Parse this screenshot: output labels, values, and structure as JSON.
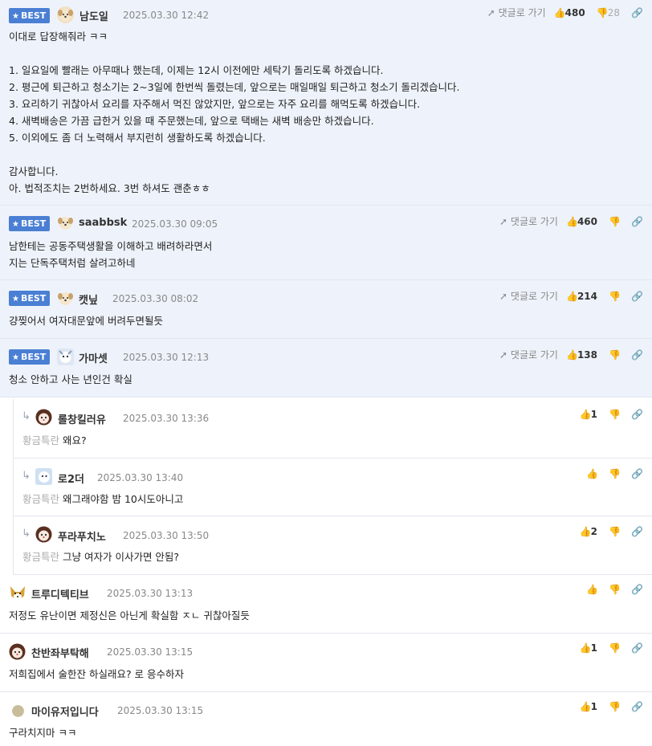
{
  "ui": {
    "goto_label": "댓글로 가기",
    "best_label": "BEST",
    "reply_tag": "황금특란"
  },
  "icons": {
    "thumb_up": "thumb-up-icon",
    "thumb_down": "thumb-down-icon",
    "link": "link-icon",
    "reply": "reply-arrow-icon",
    "arrow": "send-arrow-icon"
  },
  "comments": [
    {
      "nick": "남도일",
      "date": "2025.03.30 12:42",
      "up": "480",
      "down": "28",
      "body": "이대로 답장해줘라 ㅋㅋ\n\n1. 일요일에 빨래는 아무때나 했는데, 이제는 12시 이전에만 세탁기 돌리도록 하겠습니다.\n2. 평근에 퇴근하고 청소기는 2~3일에 한번씩 돌렸는데, 앞으로는 매일매일 퇴근하고 청소기 돌리겠습니다.\n3. 요리하기 귀찮아서 요리를 자주해서 먹진 않았지만, 앞으로는 자주 요리를 해먹도록 하겠습니다.\n4. 새벽배송은 가끔 급한거 있을 때 주문했는데, 앞으로 택배는 새벽 배송만 하겠습니다.\n5. 이외에도 좀 더 노력해서 부지런히 생활하도록 하겠습니다.\n\n감사합니다.\n아. 법적조치는 2번하세요. 3번 하셔도 괜춘ㅎㅎ"
    },
    {
      "nick": "saabbsk",
      "date": "2025.03.30 09:05",
      "up": "460",
      "down": "",
      "body": "남한테는 공동주택생활을 이해하고 배려하라면서\n지는 단독주택처럼 살려고하네"
    },
    {
      "nick": "캣닢",
      "date": "2025.03.30 08:02",
      "up": "214",
      "down": "",
      "body": "걍찢어서 여자대문앞에 버려두면될듯"
    },
    {
      "nick": "가마셋",
      "date": "2025.03.30 12:13",
      "up": "138",
      "down": "",
      "body": "청소 안하고 사는 년인건 확실"
    },
    {
      "nick": "롤창킬러유",
      "date": "2025.03.30 13:36",
      "up": "1",
      "down": "",
      "body": "왜요?"
    },
    {
      "nick": "로2더",
      "date": "2025.03.30 13:40",
      "up": "",
      "down": "",
      "body": "왜그래야함 밤 10시도아니고"
    },
    {
      "nick": "푸라푸치노",
      "date": "2025.03.30 13:50",
      "up": "2",
      "down": "",
      "body": "그냥 여자가 이사가면 안됨?"
    },
    {
      "nick": "트루디텍티브",
      "date": "2025.03.30 13:13",
      "up": "",
      "down": "",
      "body": "저정도 유난이면 제정신은 아닌게 확실함 ㅈㄴ 귀찮아질듯"
    },
    {
      "nick": "찬반좌부탁해",
      "date": "2025.03.30 13:15",
      "up": "1",
      "down": "",
      "body": "저희집에서 술한잔 하실래요? 로 응수하자"
    },
    {
      "nick": "마이유저입니다",
      "date": "2025.03.30 13:15",
      "up": "1",
      "down": "",
      "body": "구라치지마 ㅋㅋ"
    }
  ]
}
